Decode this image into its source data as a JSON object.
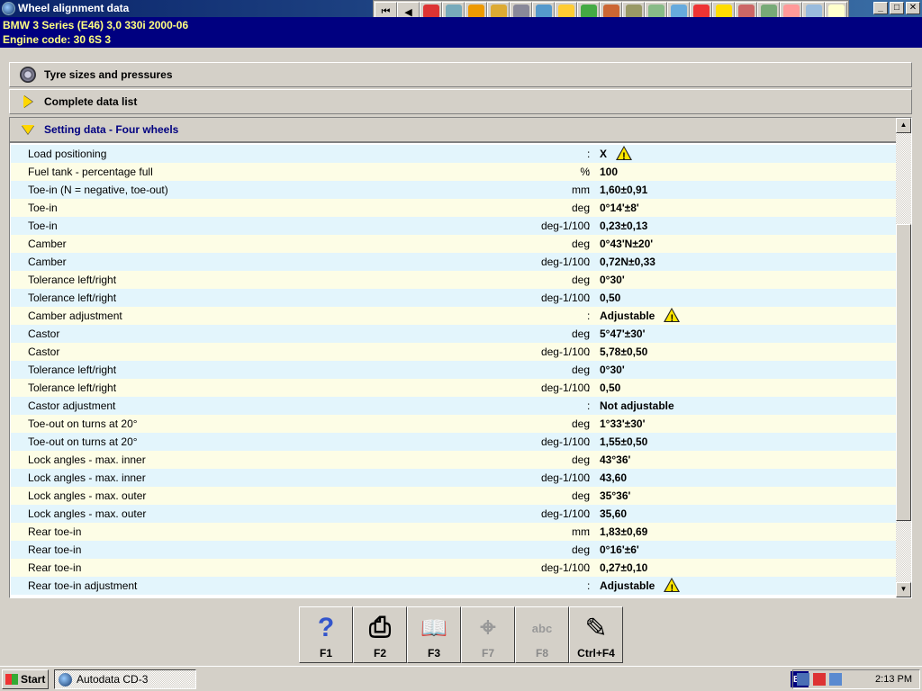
{
  "window": {
    "title": "Wheel alignment data"
  },
  "window_buttons": {
    "minimize": "_",
    "maximize": "□",
    "close": "✕"
  },
  "toolbar": {
    "icons": [
      "first-icon",
      "back-icon",
      "warning-icon",
      "vehicle-id-icon",
      "engine-icon",
      "tools-icon",
      "tyre-icon",
      "suspension-icon",
      "electrical-icon",
      "service-icon",
      "repair-icon",
      "brakes-icon",
      "belts-icon",
      "wiring-icon",
      "adjustment-icon",
      "help-icon",
      "diagnostics-icon",
      "gauge-icon",
      "airbag-icon",
      "ac-icon",
      "notes-icon"
    ]
  },
  "vehicle": {
    "line1": "BMW   3 Series (E46) 3,0 330i 2000-06",
    "line2": "Engine code: 30 6S 3"
  },
  "sections": {
    "tyres": "Tyre sizes and pressures",
    "complete": "Complete data list",
    "setting": "Setting data - Four wheels"
  },
  "rows": [
    {
      "label": "Load positioning",
      "unit": "",
      "value": "X",
      "warning": true
    },
    {
      "label": "Fuel tank - percentage full",
      "unit": "%",
      "value": "100",
      "warning": false
    },
    {
      "label": "Toe-in (N = negative, toe-out)",
      "unit": "mm",
      "value": "1,60±0,91",
      "warning": false
    },
    {
      "label": "Toe-in",
      "unit": "deg",
      "value": "0°14'±8'",
      "warning": false
    },
    {
      "label": "Toe-in",
      "unit": "deg-1/100",
      "value": "0,23±0,13",
      "warning": false
    },
    {
      "label": "Camber",
      "unit": "deg",
      "value": "0°43'N±20'",
      "warning": false
    },
    {
      "label": "Camber",
      "unit": "deg-1/100",
      "value": "0,72N±0,33",
      "warning": false
    },
    {
      "label": "Tolerance left/right",
      "unit": "deg",
      "value": "0°30'",
      "warning": false
    },
    {
      "label": "Tolerance left/right",
      "unit": "deg-1/100",
      "value": "0,50",
      "warning": false
    },
    {
      "label": "Camber adjustment",
      "unit": "",
      "value": "Adjustable",
      "warning": true
    },
    {
      "label": "Castor",
      "unit": "deg",
      "value": "5°47'±30'",
      "warning": false
    },
    {
      "label": "Castor",
      "unit": "deg-1/100",
      "value": "5,78±0,50",
      "warning": false
    },
    {
      "label": "Tolerance left/right",
      "unit": "deg",
      "value": "0°30'",
      "warning": false
    },
    {
      "label": "Tolerance left/right",
      "unit": "deg-1/100",
      "value": "0,50",
      "warning": false
    },
    {
      "label": "Castor adjustment",
      "unit": "",
      "value": "Not adjustable",
      "warning": false
    },
    {
      "label": "Toe-out on turns at 20°",
      "unit": "deg",
      "value": "1°33'±30'",
      "warning": false
    },
    {
      "label": "Toe-out on turns at 20°",
      "unit": "deg-1/100",
      "value": "1,55±0,50",
      "warning": false
    },
    {
      "label": "Lock angles - max. inner",
      "unit": "deg",
      "value": "43°36'",
      "warning": false
    },
    {
      "label": "Lock angles - max. inner",
      "unit": "deg-1/100",
      "value": "43,60",
      "warning": false
    },
    {
      "label": "Lock angles - max. outer",
      "unit": "deg",
      "value": "35°36'",
      "warning": false
    },
    {
      "label": "Lock angles - max. outer",
      "unit": "deg-1/100",
      "value": "35,60",
      "warning": false
    },
    {
      "label": "Rear toe-in",
      "unit": "mm",
      "value": "1,83±0,69",
      "warning": false
    },
    {
      "label": "Rear toe-in",
      "unit": "deg",
      "value": "0°16'±6'",
      "warning": false
    },
    {
      "label": "Rear toe-in",
      "unit": "deg-1/100",
      "value": "0,27±0,10",
      "warning": false
    },
    {
      "label": "Rear toe-in adjustment",
      "unit": "",
      "value": "Adjustable",
      "warning": true
    }
  ],
  "fkeys": [
    {
      "label": "F1",
      "glyph": "?",
      "icon": "help-icon",
      "enabled": true
    },
    {
      "label": "F2",
      "glyph": "⎙",
      "icon": "printer-icon",
      "enabled": true
    },
    {
      "label": "F3",
      "glyph": "📖",
      "icon": "book-icon",
      "enabled": true
    },
    {
      "label": "F7",
      "glyph": "⌖",
      "icon": "magnifier-icon",
      "enabled": false
    },
    {
      "label": "F8",
      "glyph": "abc",
      "icon": "definitions-icon",
      "enabled": false
    },
    {
      "label": "Ctrl+F4",
      "glyph": "✎",
      "icon": "notes-icon",
      "enabled": true
    }
  ],
  "taskbar": {
    "start": "Start",
    "app": "Autodata CD-3",
    "lang": "EN",
    "clock": "2:13 PM"
  }
}
